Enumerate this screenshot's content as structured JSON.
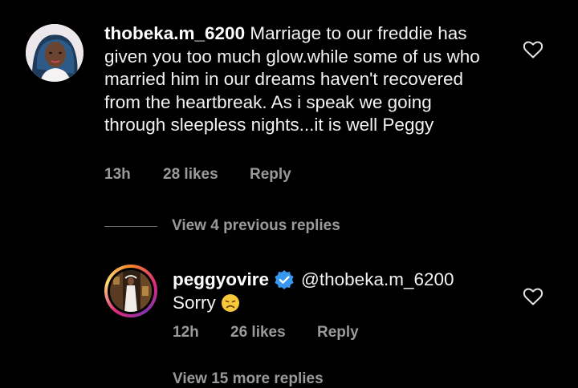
{
  "comment": {
    "username": "thobeka.m_6200",
    "text": "Marriage to our freddie has given you too much glow.while some of us who married him in our dreams haven't recovered from the heartbreak. As i speak we going through sleepless nights...it is well Peggy",
    "time": "13h",
    "likes": "28 likes",
    "reply_label": "Reply"
  },
  "view_previous": "View 4 previous replies",
  "reply": {
    "username": "peggyovire",
    "mention": "@thobeka.m_6200",
    "text": "Sorry",
    "emoji": "disappointed-face",
    "time": "12h",
    "likes": "26 likes",
    "reply_label": "Reply"
  },
  "view_more": "View 15 more replies",
  "colors": {
    "background": "#000000",
    "text": "#f2f2f2",
    "muted": "#9a9a9a",
    "verified": "#3897f0"
  }
}
